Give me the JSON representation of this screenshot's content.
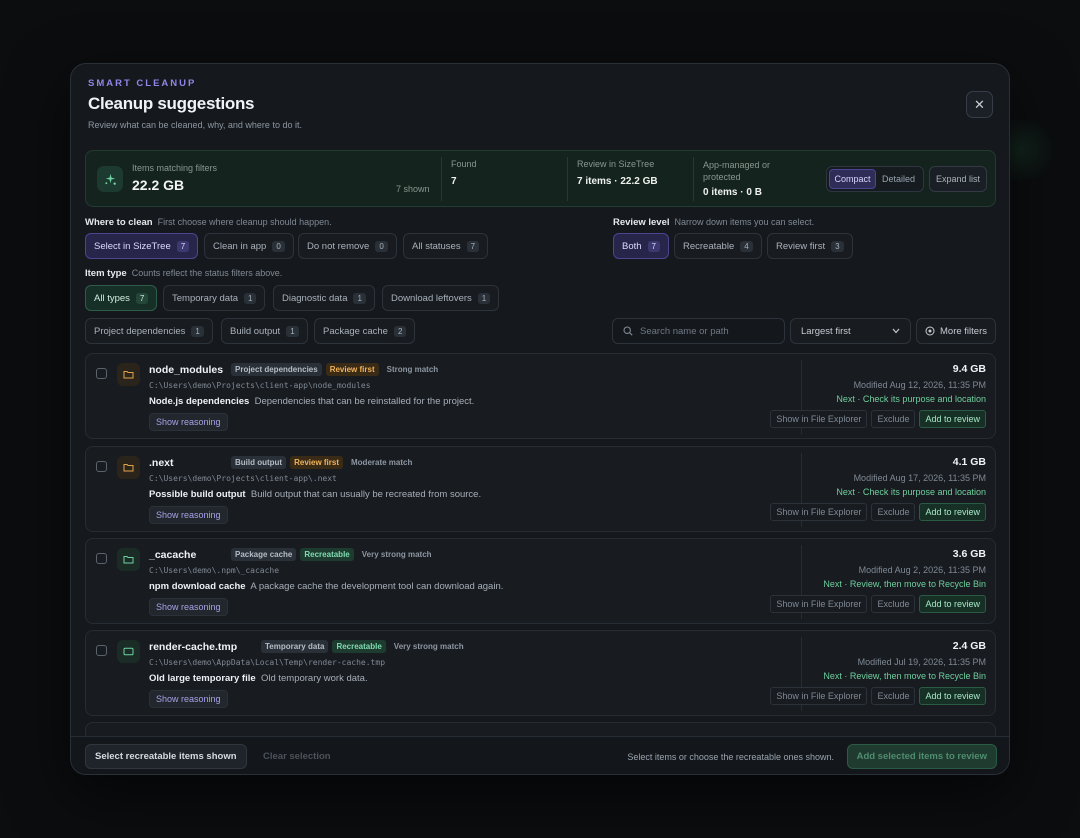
{
  "header": {
    "eyebrow": "SMART CLEANUP",
    "title": "Cleanup suggestions",
    "subtitle": "Review what can be cleaned, why, and where to do it.",
    "close_label": "✕"
  },
  "summary": {
    "matching_label": "Items matching filters",
    "matching_value": "22.2 GB",
    "shown": "7 shown",
    "found_label": "Found",
    "found_value": "7",
    "review_label": "Review in SizeTree",
    "review_value": "7 items · 22.2 GB",
    "managed_label": "App-managed or protected",
    "managed_value": "0 items · 0 B",
    "view_compact": "Compact",
    "view_detailed": "Detailed",
    "expand_label": "Expand list"
  },
  "where": {
    "label": "Where to clean",
    "hint": "First choose where cleanup should happen.",
    "chips": [
      {
        "label": "Select in SizeTree",
        "count": "7"
      },
      {
        "label": "Clean in app",
        "count": "0"
      },
      {
        "label": "Do not remove",
        "count": "0"
      },
      {
        "label": "All statuses",
        "count": "7"
      }
    ]
  },
  "review_level": {
    "label": "Review level",
    "hint": "Narrow down items you can select.",
    "chips": [
      {
        "label": "Both",
        "count": "7"
      },
      {
        "label": "Recreatable",
        "count": "4"
      },
      {
        "label": "Review first",
        "count": "3"
      }
    ]
  },
  "item_type": {
    "label": "Item type",
    "hint": "Counts reflect the status filters above.",
    "chips": [
      {
        "label": "All types",
        "count": "7"
      },
      {
        "label": "Temporary data",
        "count": "1"
      },
      {
        "label": "Diagnostic data",
        "count": "1"
      },
      {
        "label": "Download leftovers",
        "count": "1"
      },
      {
        "label": "Project dependencies",
        "count": "1"
      },
      {
        "label": "Build output",
        "count": "1"
      },
      {
        "label": "Package cache",
        "count": "2"
      }
    ]
  },
  "search": {
    "placeholder": "Search name or path"
  },
  "sort": {
    "value": "Largest first"
  },
  "more_filters": "More filters",
  "items": [
    {
      "name": "node_modules",
      "category": "Project dependencies",
      "level": "Review first",
      "match": "Strong match",
      "path": "C:\\Users\\demo\\Projects\\client-app\\node_modules",
      "desc_title": "Node.js dependencies",
      "desc": "Dependencies that can be reinstalled for the project.",
      "reason": "Show reasoning",
      "size": "9.4 GB",
      "modified": "Modified Aug 12, 2026, 11:35 PM",
      "next": "Next · Check its purpose and location"
    },
    {
      "name": ".next",
      "category": "Build output",
      "level": "Review first",
      "match": "Moderate match",
      "path": "C:\\Users\\demo\\Projects\\client-app\\.next",
      "desc_title": "Possible build output",
      "desc": "Build output that can usually be recreated from source.",
      "reason": "Show reasoning",
      "size": "4.1 GB",
      "modified": "Modified Aug 17, 2026, 11:35 PM",
      "next": "Next · Check its purpose and location"
    },
    {
      "name": "_cacache",
      "category": "Package cache",
      "level": "Recreatable",
      "match": "Very strong match",
      "path": "C:\\Users\\demo\\.npm\\_cacache",
      "desc_title": "npm download cache",
      "desc": "A package cache the development tool can download again.",
      "reason": "Show reasoning",
      "size": "3.6 GB",
      "modified": "Modified Aug 2, 2026, 11:35 PM",
      "next": "Next · Review, then move to Recycle Bin"
    },
    {
      "name": "render-cache.tmp",
      "category": "Temporary data",
      "level": "Recreatable",
      "match": "Very strong match",
      "path": "C:\\Users\\demo\\AppData\\Local\\Temp\\render-cache.tmp",
      "desc_title": "Old large temporary file",
      "desc": "Old temporary work data.",
      "reason": "Show reasoning",
      "size": "2.4 GB",
      "modified": "Modified Jul 19, 2026, 11:35 PM",
      "next": "Next · Review, then move to Recycle Bin"
    }
  ],
  "row_actions": {
    "explorer": "Show in File Explorer",
    "exclude": "Exclude",
    "add": "Add to review"
  },
  "footer": {
    "select_recreatable": "Select recreatable items shown",
    "clear": "Clear selection",
    "hint": "Select items or choose the recreatable ones shown.",
    "add_selected": "Add selected items to review"
  }
}
